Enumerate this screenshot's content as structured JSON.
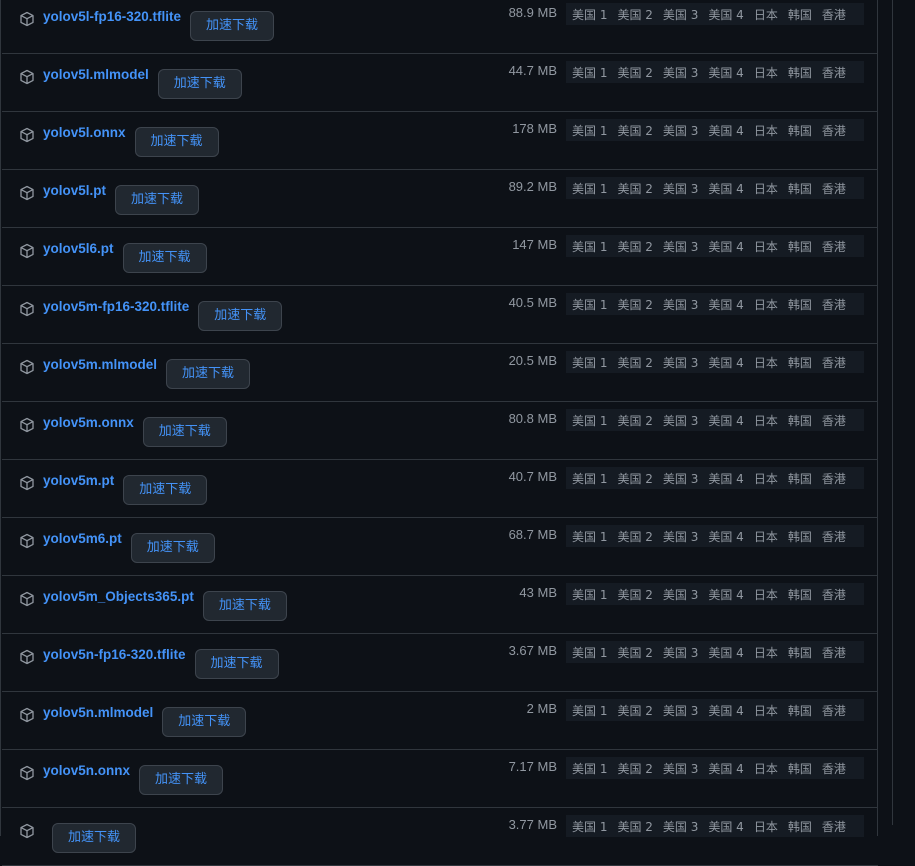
{
  "accent_color": "#4493f8",
  "icon": "package-icon",
  "accel_label": "加速下载",
  "mirrors": [
    "美国 1",
    "美国 2",
    "美国 3",
    "美国 4",
    "日本",
    "韩国",
    "香港"
  ],
  "assets": [
    {
      "name": "yolov5l-fp16-320.tflite",
      "size": "88.9 MB"
    },
    {
      "name": "yolov5l.mlmodel",
      "size": "44.7 MB"
    },
    {
      "name": "yolov5l.onnx",
      "size": "178 MB"
    },
    {
      "name": "yolov5l.pt",
      "size": "89.2 MB"
    },
    {
      "name": "yolov5l6.pt",
      "size": "147 MB"
    },
    {
      "name": "yolov5m-fp16-320.tflite",
      "size": "40.5 MB"
    },
    {
      "name": "yolov5m.mlmodel",
      "size": "20.5 MB"
    },
    {
      "name": "yolov5m.onnx",
      "size": "80.8 MB"
    },
    {
      "name": "yolov5m.pt",
      "size": "40.7 MB"
    },
    {
      "name": "yolov5m6.pt",
      "size": "68.7 MB"
    },
    {
      "name": "yolov5m_Objects365.pt",
      "size": "43 MB"
    },
    {
      "name": "yolov5n-fp16-320.tflite",
      "size": "3.67 MB"
    },
    {
      "name": "yolov5n.mlmodel",
      "size": "2 MB"
    },
    {
      "name": "yolov5n.onnx",
      "size": "7.17 MB"
    },
    {
      "name": "",
      "size": "3.77 MB"
    }
  ]
}
